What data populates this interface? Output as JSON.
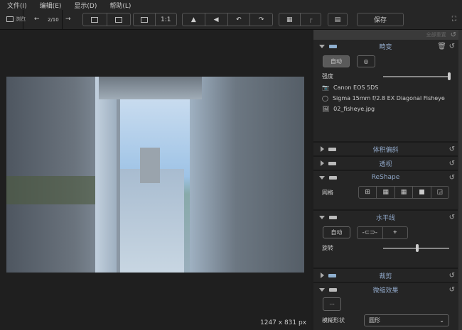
{
  "menu": [
    "文件(I)",
    "编辑(E)",
    "显示(D)",
    "帮助(L)"
  ],
  "toolbar": {
    "browse": "浏览",
    "page": "2/10",
    "one_to_one": "1:1",
    "save": "保存"
  },
  "status": {
    "dimensions": "1247 x 831 px"
  },
  "panel": {
    "reset_all": "全部重置",
    "distortion": {
      "title": "畸变",
      "auto": "自动",
      "strength_label": "强度",
      "strength_value": 1.0,
      "camera": "Canon EOS 5DS",
      "lens": "Sigma 15mm f/2.8 EX Diagonal Fisheye",
      "file": "02_fisheye.jpg"
    },
    "volume": {
      "title": "体积偏斜"
    },
    "perspective": {
      "title": "透视"
    },
    "reshape": {
      "title": "ReShape",
      "grid_label": "网格"
    },
    "horizon": {
      "title": "水平线",
      "auto": "自动",
      "rotate_label": "旋转",
      "rotate_value": 0.5
    },
    "crop": {
      "title": "裁剪"
    },
    "tiltshift": {
      "title": "微缩效果",
      "blur_shape_label": "模糊形状",
      "blur_shape_value": "圆形"
    }
  },
  "colors": {
    "accent_title": "#8fa6c6",
    "background": "#1e1e1e"
  }
}
